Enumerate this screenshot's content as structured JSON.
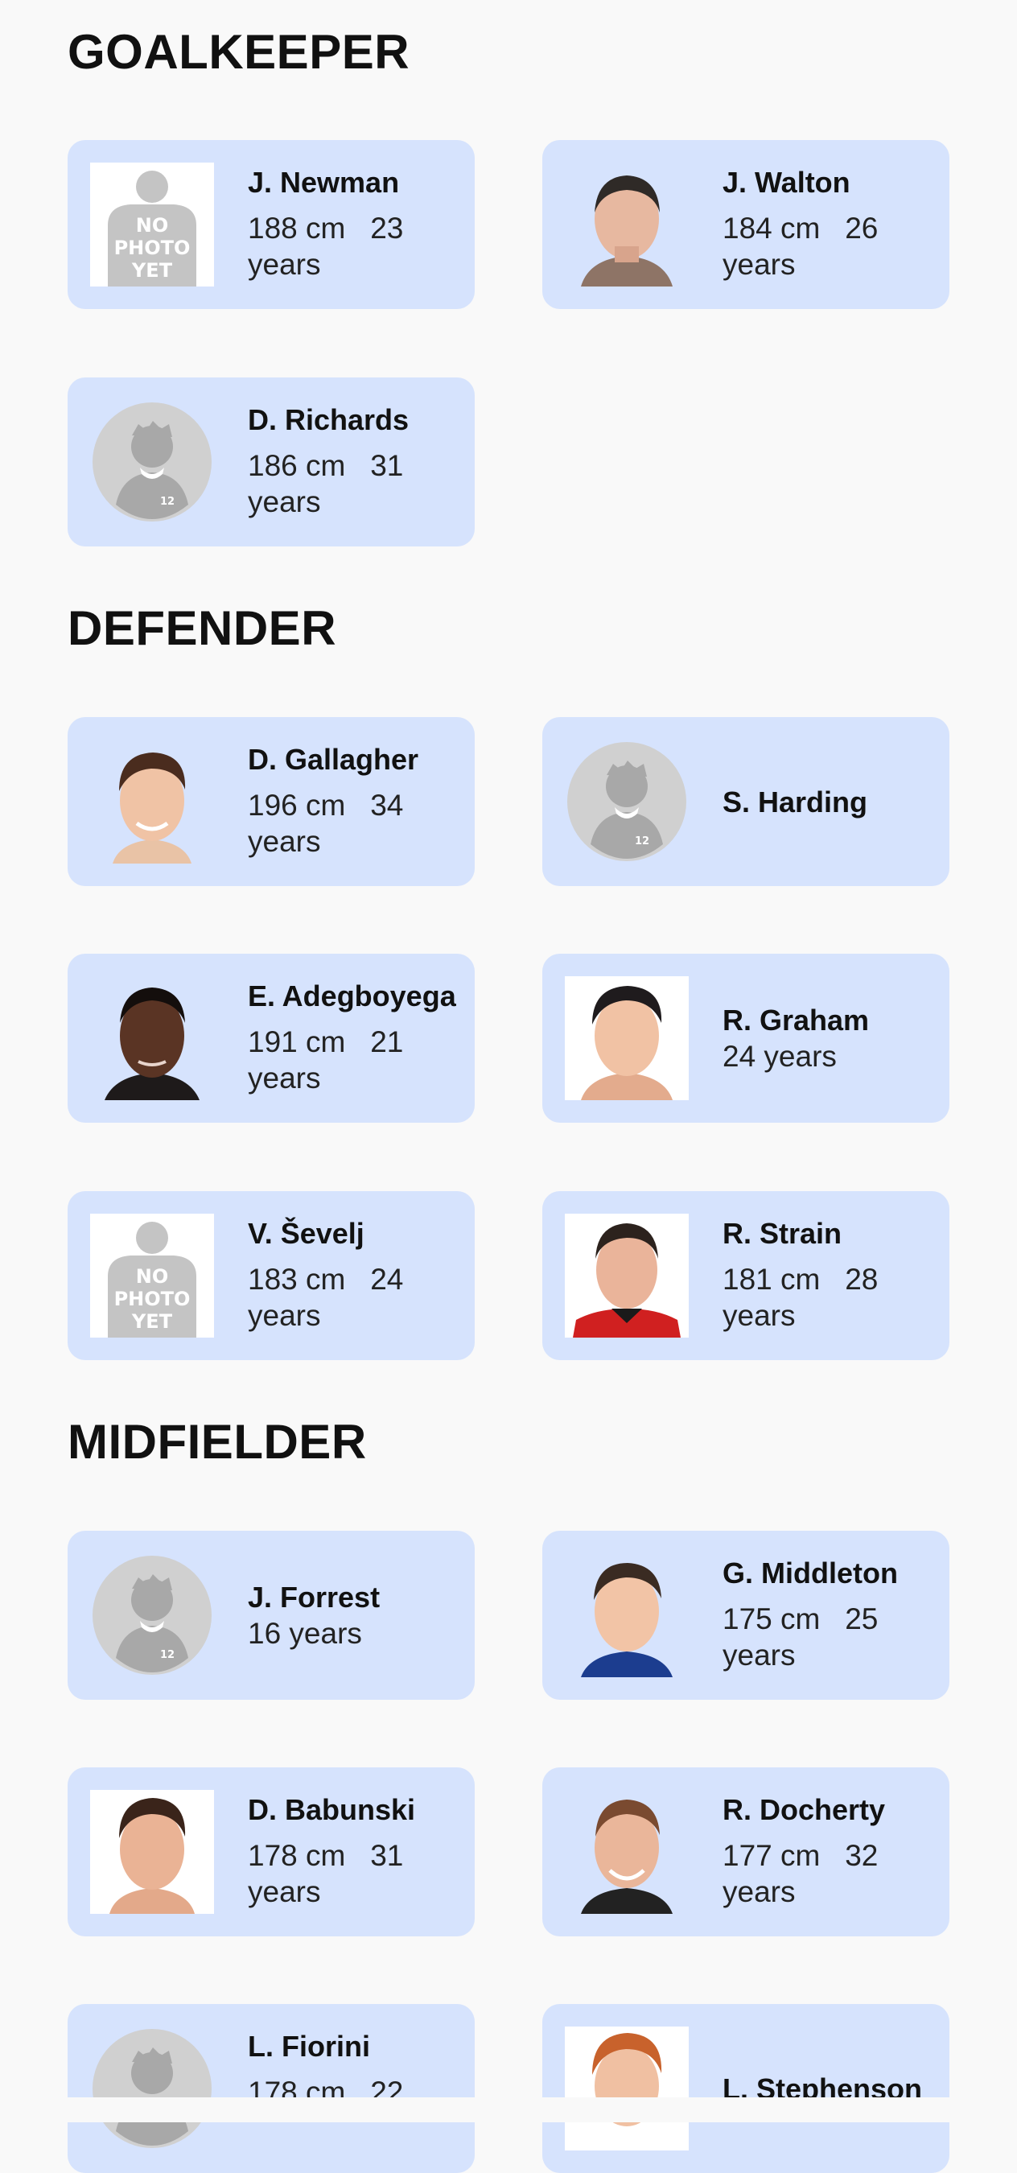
{
  "sections": [
    {
      "title": "GOALKEEPER"
    },
    {
      "title": "DEFENDER"
    },
    {
      "title": "MIDFIELDER"
    }
  ],
  "players": [
    {
      "name": "J. Newman",
      "height": "188 cm",
      "age": "23",
      "age_unit": "years",
      "photo": "no-photo-yet"
    },
    {
      "name": "J. Walton",
      "height": "184 cm",
      "age": "26",
      "age_unit": "years",
      "photo": "player-photo"
    },
    {
      "name": "D. Richards",
      "height": "186 cm",
      "age": "31",
      "age_unit": "years",
      "photo": "avatar-placeholder"
    },
    {
      "name": "D. Gallagher",
      "height": "196 cm",
      "age": "34",
      "age_unit": "years",
      "photo": "player-photo"
    },
    {
      "name": "S. Harding",
      "photo": "avatar-placeholder"
    },
    {
      "name": "E. Adegboyega",
      "height": "191 cm",
      "age": "21",
      "age_unit": "years",
      "photo": "player-photo"
    },
    {
      "name": "R. Graham",
      "age_line": "24 years",
      "photo": "player-photo"
    },
    {
      "name": "V. Ševelj",
      "height": "183 cm",
      "age": "24",
      "age_unit": "years",
      "photo": "no-photo-yet"
    },
    {
      "name": "R. Strain",
      "height": "181 cm",
      "age": "28",
      "age_unit": "years",
      "photo": "player-photo"
    },
    {
      "name": "J. Forrest",
      "age_line": "16 years",
      "photo": "avatar-placeholder"
    },
    {
      "name": "G. Middleton",
      "height": "175 cm",
      "age": "25",
      "age_unit": "years",
      "photo": "player-photo"
    },
    {
      "name": "D. Babunski",
      "height": "178 cm",
      "age": "31",
      "age_unit": "years",
      "photo": "player-photo"
    },
    {
      "name": "R. Docherty",
      "height": "177 cm",
      "age": "32",
      "age_unit": "years",
      "photo": "player-photo"
    },
    {
      "name": "L. Fiorini",
      "height": "178 cm",
      "age": "22",
      "photo": "avatar-placeholder"
    },
    {
      "name": "L. Stephenson",
      "photo": "player-photo"
    }
  ],
  "placeholder_text": {
    "no_photo": [
      "NO",
      "PHOTO",
      "YET"
    ],
    "shirt_number": "12"
  },
  "colors": {
    "card_bg": "#d6e3fd",
    "page_bg": "#f9f9f9"
  }
}
